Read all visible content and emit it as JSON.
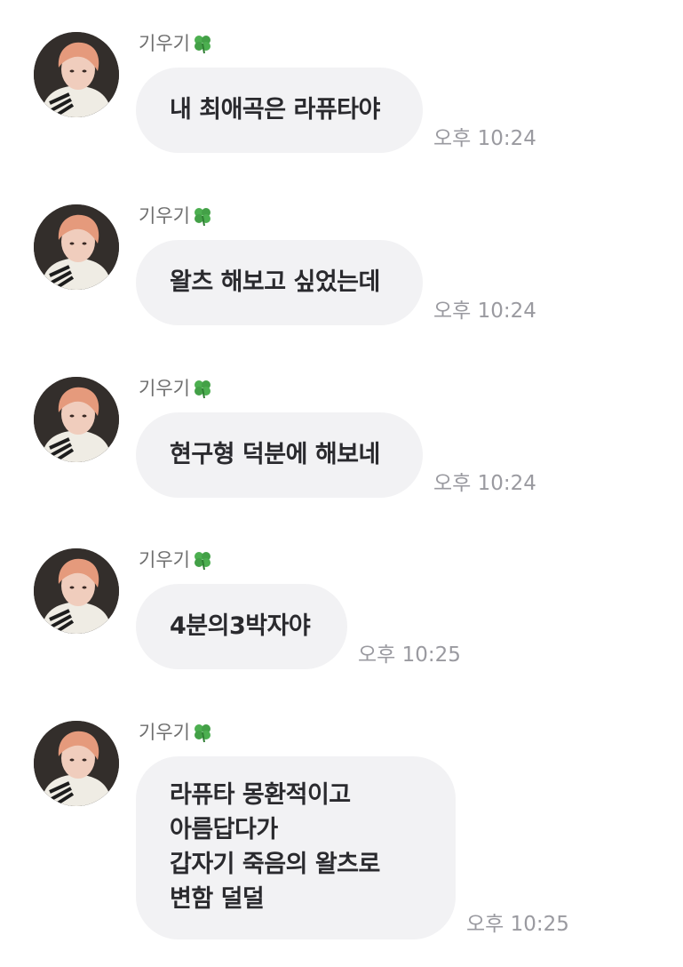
{
  "sender_name": "기우기",
  "sender_emoji": "🍀",
  "messages": [
    {
      "lines": [
        "내 최애곡은 라퓨타야"
      ],
      "time": "오후 10:24"
    },
    {
      "lines": [
        "왈츠 해보고 싶었는데"
      ],
      "time": "오후 10:24"
    },
    {
      "lines": [
        "현구형 덕분에 해보네"
      ],
      "time": "오후 10:24"
    },
    {
      "lines": [
        "4분의3박자야"
      ],
      "time": "오후 10:25"
    },
    {
      "lines": [
        "라퓨타 몽환적이고",
        "아름답다가",
        "갑자기 죽음의 왈츠로",
        "변함 덜덜"
      ],
      "time": "오후 10:25"
    }
  ],
  "colors": {
    "bubble": "#f2f2f4",
    "text": "#2a2a2e",
    "sender": "#6e6e6e",
    "time": "#9a9aa0",
    "clover": "#4caf50"
  },
  "icons": {
    "clover": "four-leaf-clover-icon",
    "avatar": "profile-photo"
  }
}
